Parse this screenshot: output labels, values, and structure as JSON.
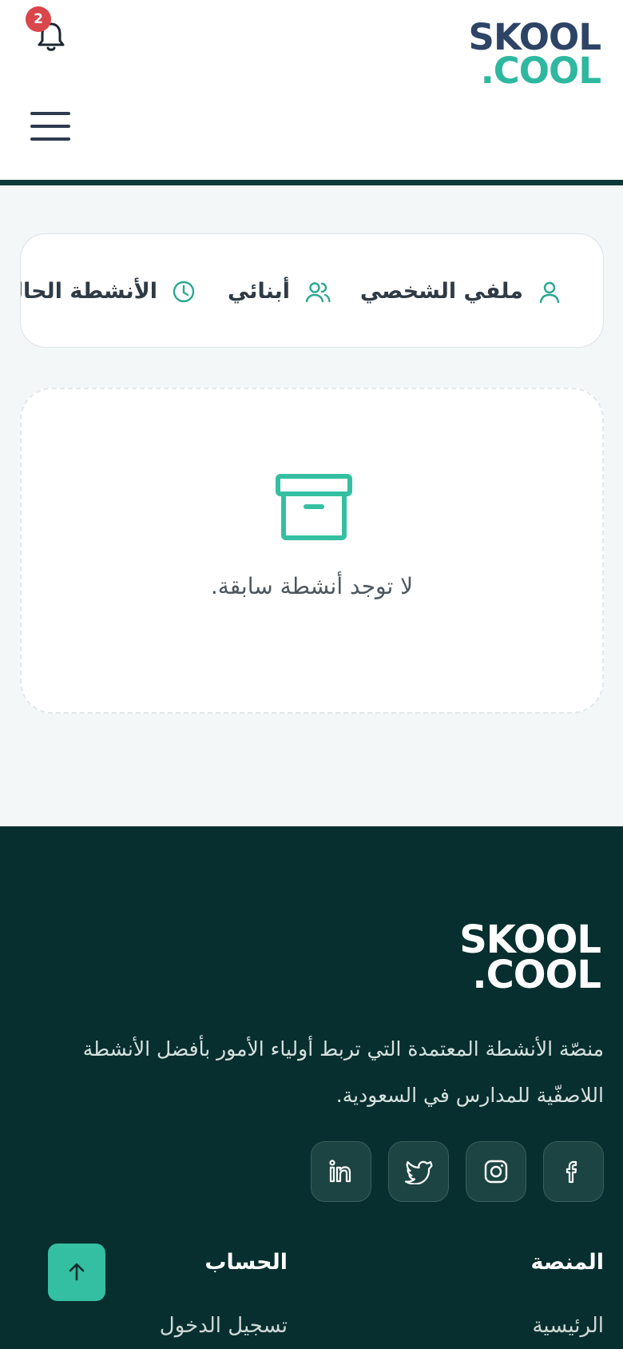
{
  "header": {
    "logo_line1": "SKOOL",
    "logo_line2": ".COOL",
    "notification_count": "2",
    "icons": [
      "bell-icon",
      "hamburger-menu-icon"
    ]
  },
  "tabs": [
    {
      "label": "ملفي الشخصي",
      "icon": "user-icon"
    },
    {
      "label": "أبنائي",
      "icon": "users-icon"
    },
    {
      "label": "الأنشطة الحالية",
      "icon": "clock-icon"
    }
  ],
  "empty_state": {
    "icon": "archive-box-icon",
    "message": "لا توجد أنشطة سابقة."
  },
  "footer": {
    "logo_line1": "SKOOL",
    "logo_line2": ".COOL",
    "description": "منصّة الأنشطة المعتمدة التي تربط أولياء الأمور بأفضل الأنشطة اللاصفّية للمدارس في السعودية.",
    "social": [
      "facebook-icon",
      "instagram-icon",
      "twitter-icon",
      "linkedin-icon"
    ],
    "columns": [
      {
        "heading": "المنصة",
        "items": [
          "الرئيسية"
        ]
      },
      {
        "heading": "الحساب",
        "items": [
          "تسجيل الدخول"
        ]
      }
    ]
  },
  "colors": {
    "accent": "#35bfa2",
    "brand_dark": "#2d4466",
    "footer_bg": "#072f2f",
    "badge": "#d9464b"
  }
}
